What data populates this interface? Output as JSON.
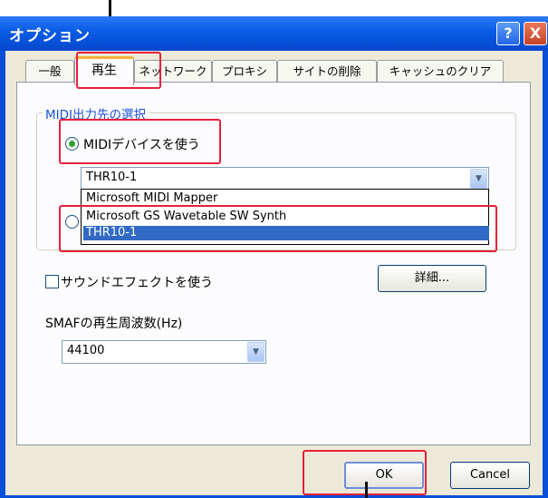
{
  "window": {
    "title": "オプション",
    "help_glyph": "?",
    "close_glyph": "X"
  },
  "tabs": [
    {
      "label": "一般"
    },
    {
      "label": "再生"
    },
    {
      "label": "ネットワーク"
    },
    {
      "label": "プロキシ"
    },
    {
      "label": "サイトの削除"
    },
    {
      "label": "キャッシュのクリア"
    }
  ],
  "midi_group": {
    "legend": "MIDI出力先の選択",
    "use_device_label": "MIDIデバイスを使う",
    "device_selected": "THR10-1",
    "device_options": [
      "Microsoft MIDI Mapper",
      "Microsoft GS Wavetable SW Synth",
      "THR10-1"
    ],
    "highlighted_option": "THR10-1"
  },
  "sound_effect_label": "サウンドエフェクトを使う",
  "details_button": "詳細...",
  "smaf": {
    "label": "SMAFの再生周波数(Hz)",
    "value": "44100"
  },
  "buttons": {
    "ok": "OK",
    "cancel": "Cancel"
  },
  "colors": {
    "title_bar": "#0a4fd8",
    "selection": "#316ac5",
    "highlight_box": "#e5203a",
    "group_legend": "#1b4fd6"
  }
}
